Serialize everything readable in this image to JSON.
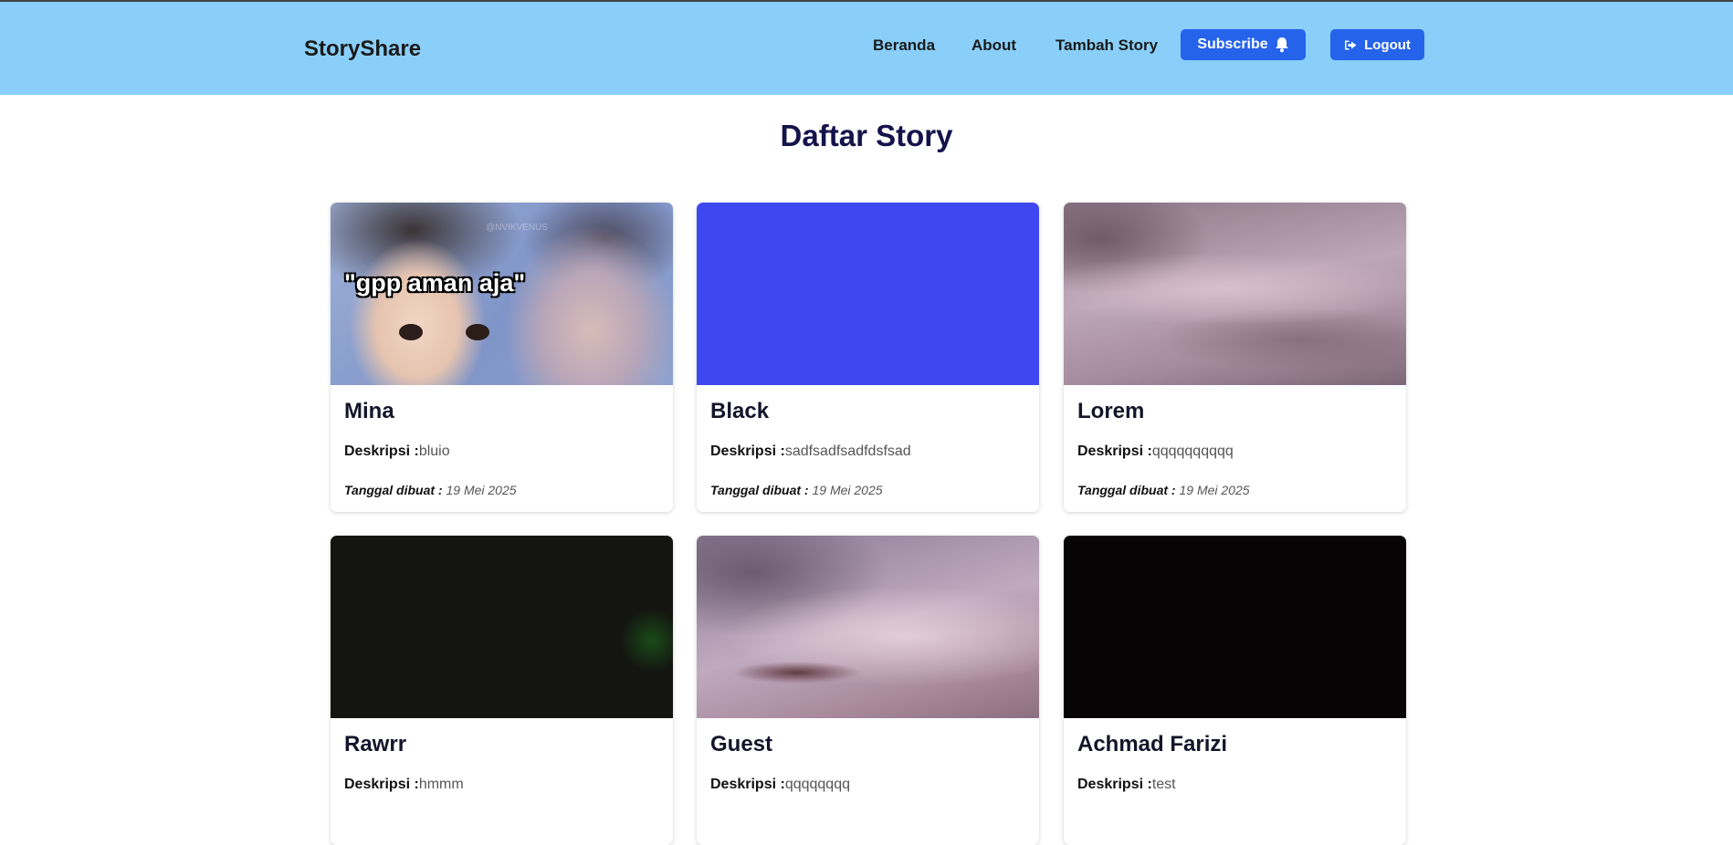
{
  "navbar": {
    "brand": "StoryShare",
    "links": [
      "Beranda",
      "About",
      "Tambah Story"
    ],
    "subscribe_label": "Subscribe",
    "logout_label": "Logout",
    "bg_color": "#89cff9",
    "button_color": "#2563eb"
  },
  "page_title": "Daftar Story",
  "labels": {
    "description": "Deskripsi :",
    "date": "Tanggal dibuat :"
  },
  "stories": [
    {
      "name": "Mina",
      "description": "bluio",
      "date": "19 Mei 2025",
      "image_caption": "\"gpp aman aja\"",
      "watermark": "@NVIKVENUS"
    },
    {
      "name": "Black",
      "description": "sadfsadfsadfdsfsad",
      "date": "19 Mei 2025"
    },
    {
      "name": "Lorem",
      "description": "qqqqqqqqqq",
      "date": "19 Mei 2025"
    },
    {
      "name": "Rawrr",
      "description": "hmmm",
      "date": ""
    },
    {
      "name": "Guest",
      "description": "qqqqqqqq",
      "date": ""
    },
    {
      "name": "Achmad Farizi",
      "description": "test",
      "date": ""
    }
  ]
}
